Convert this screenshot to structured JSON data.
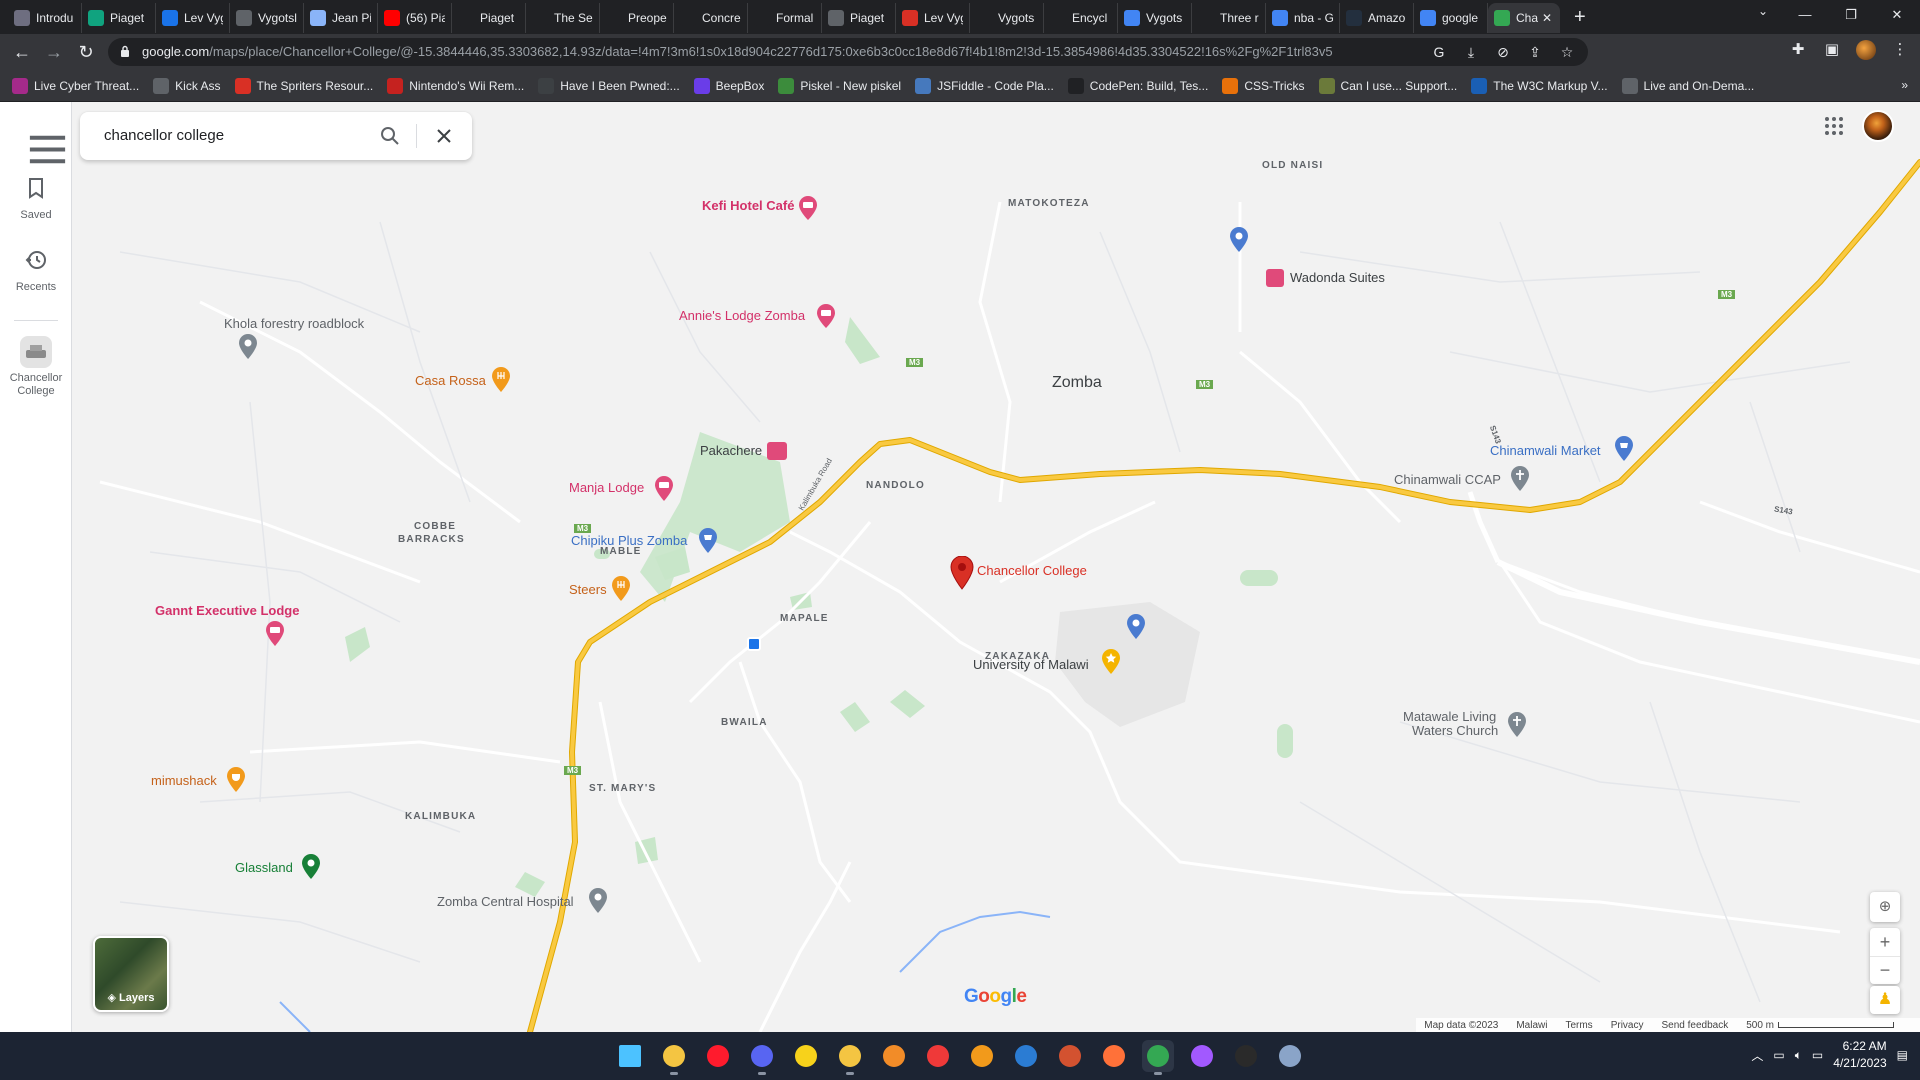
{
  "browser": {
    "tabs": [
      {
        "title": "Introdu",
        "icon": "openai-icon",
        "color": "#6e6e80"
      },
      {
        "title": "Piaget",
        "icon": "chatgpt-icon",
        "color": "#10a37f"
      },
      {
        "title": "Lev Vyg",
        "icon": "et-icon",
        "color": "#1a73e8"
      },
      {
        "title": "Vygotsl",
        "icon": "page-icon",
        "color": "#5f6368"
      },
      {
        "title": "Jean Pi",
        "icon": "page-icon",
        "color": "#8ab4f8"
      },
      {
        "title": "(56) Pia",
        "icon": "youtube-icon",
        "color": "#ff0000"
      },
      {
        "title": "Piaget",
        "icon": "wikipedia-icon",
        "color": "#202124"
      },
      {
        "title": "The Se",
        "icon": "wikipedia-icon",
        "color": "#202124"
      },
      {
        "title": "Preope",
        "icon": "wikipedia-icon",
        "color": "#202124"
      },
      {
        "title": "Concre",
        "icon": "wikipedia-icon",
        "color": "#202124"
      },
      {
        "title": "Formal",
        "icon": "wikipedia-icon",
        "color": "#202124"
      },
      {
        "title": "Piaget",
        "icon": "page-icon",
        "color": "#5f6368"
      },
      {
        "title": "Lev Vyg",
        "icon": "flag-icon",
        "color": "#d93025"
      },
      {
        "title": "Vygots",
        "icon": "page-icon",
        "color": "#202124"
      },
      {
        "title": "Encycl",
        "icon": "page-icon",
        "color": "#202124"
      },
      {
        "title": "Vygots",
        "icon": "google-icon",
        "color": "#4285f4"
      },
      {
        "title": "Three r",
        "icon": "wikipedia-icon",
        "color": "#202124"
      },
      {
        "title": "nba - G",
        "icon": "google-icon",
        "color": "#4285f4"
      },
      {
        "title": "Amazo",
        "icon": "amazon-icon",
        "color": "#232f3e"
      },
      {
        "title": "google",
        "icon": "google-icon",
        "color": "#4285f4"
      }
    ],
    "active_tab": {
      "title": "Cha",
      "icon": "maps-pin-icon"
    },
    "new_tab": "+",
    "url_host": "google.com",
    "url_path": "/maps/place/Chancellor+College/@-15.3844446,35.3303682,14.93z/data=!4m7!3m6!1s0x18d904c22776d175:0xe6b3c0cc18e8d67f!4b1!8m2!3d-15.3854986!4d35.3304522!16s%2Fg%2F1trl83v5",
    "bookmarks": [
      {
        "label": "Live Cyber Threat...",
        "color": "#a52a8a"
      },
      {
        "label": "Kick Ass",
        "color": "#5f6368"
      },
      {
        "label": "The Spriters Resour...",
        "color": "#d93025"
      },
      {
        "label": "Nintendo's Wii Rem...",
        "color": "#c5221f"
      },
      {
        "label": "Have I Been Pwned:...",
        "color": "#3c4043"
      },
      {
        "label": "BeepBox",
        "color": "#6a3de8"
      },
      {
        "label": "Piskel - New piskel",
        "color": "#3c8c3c"
      },
      {
        "label": "JSFiddle - Code Pla...",
        "color": "#4679bd"
      },
      {
        "label": "CodePen: Build, Tes...",
        "color": "#202124"
      },
      {
        "label": "CSS-Tricks",
        "color": "#e8710a"
      },
      {
        "label": "Can I use... Support...",
        "color": "#6b7a3a"
      },
      {
        "label": "The W3C Markup V...",
        "color": "#1a5fb4"
      },
      {
        "label": "Live and On-Dema...",
        "color": "#5f6368"
      }
    ],
    "bookmarks_more": "»"
  },
  "maps": {
    "search_value": "chancellor college",
    "rail": [
      {
        "label": "Saved",
        "icon": "bookmark-icon"
      },
      {
        "label": "Recents",
        "icon": "history-icon"
      },
      {
        "label": "Chancellor College",
        "icon": "place-thumb-icon"
      }
    ],
    "layers_label": "Layers",
    "places": [
      {
        "name": "Kefi Hotel Café",
        "kind": "hotel",
        "color": "#e04a7a"
      },
      {
        "name": "Annie's Lodge Zomba",
        "kind": "hotel",
        "color": "#e04a7a"
      },
      {
        "name": "Wadonda Suites",
        "kind": "hotel",
        "color": "#5f6368"
      },
      {
        "name": "Khola forestry roadblock",
        "kind": "landmark",
        "color": "#5f6368"
      },
      {
        "name": "Casa Rossa",
        "kind": "food",
        "color": "#e8710a"
      },
      {
        "name": "Zomba",
        "kind": "city",
        "color": "#3c4043"
      },
      {
        "name": "Pakachere",
        "kind": "hotel",
        "color": "#5f6368"
      },
      {
        "name": "Manja Lodge",
        "kind": "hotel",
        "color": "#e04a7a"
      },
      {
        "name": "Chipiku Plus Zomba",
        "kind": "shop",
        "color": "#4a7bd0"
      },
      {
        "name": "Chancellor College",
        "kind": "selected",
        "color": "#d93025"
      },
      {
        "name": "Steers",
        "kind": "food",
        "color": "#e8710a"
      },
      {
        "name": "Gannt Executive Lodge",
        "kind": "hotel",
        "color": "#e04a7a"
      },
      {
        "name": "University of Malawi",
        "kind": "university",
        "color": "#3c4043"
      },
      {
        "name": "Chinamwali Market",
        "kind": "shop",
        "color": "#4a7bd0"
      },
      {
        "name": "Chinamwali CCAP",
        "kind": "church",
        "color": "#7d8790"
      },
      {
        "name": "Matawale Living",
        "kind": "church",
        "color": "#7d8790"
      },
      {
        "name": "Waters Church",
        "kind": "church",
        "color": "#7d8790"
      },
      {
        "name": "mimushack",
        "kind": "food",
        "color": "#e8710a"
      },
      {
        "name": "Glassland",
        "kind": "park",
        "color": "#188038"
      },
      {
        "name": "Zomba Central Hospital",
        "kind": "hospital",
        "color": "#7d8790"
      }
    ],
    "areas": [
      "OLD NAISI",
      "MATOKOTEZA",
      "NANDOLO",
      "COBBE",
      "BARRACKS",
      "MABLE",
      "MAPALE",
      "ZAKAZAKA",
      "BWAILA",
      "ST. MARY'S",
      "KALIMBUKA"
    ],
    "road_labels": {
      "m3": "M3",
      "s143": "S143",
      "kalimbuka_road": "Kalimbuka Road"
    },
    "attribution": {
      "map_data": "Map data ©2023",
      "region": "Malawi",
      "terms": "Terms",
      "privacy": "Privacy",
      "feedback": "Send feedback",
      "scale": "500 m"
    },
    "controls": {
      "zoom_in": "+",
      "zoom_out": "−"
    },
    "brand": "Google",
    "colors": {
      "highway": "#f9c941",
      "highway_border": "#e0a800",
      "park": "#c8e6c9",
      "water": "#8ab4f8",
      "map_bg": "#f2f2f2",
      "selected_pin": "#d93025"
    }
  },
  "taskbar": {
    "apps": [
      {
        "name": "windows-start-icon",
        "color": "#4cc2ff"
      },
      {
        "name": "file-explorer-icon",
        "color": "#f4c542"
      },
      {
        "name": "opera-icon",
        "color": "#ff1b2d"
      },
      {
        "name": "discord-icon",
        "color": "#5865f2"
      },
      {
        "name": "notes-icon",
        "color": "#f7d21b"
      },
      {
        "name": "folder-icon",
        "color": "#f4c542"
      },
      {
        "name": "gdevelop-icon",
        "color": "#f28c28"
      },
      {
        "name": "vivaldi-icon",
        "color": "#ef3939"
      },
      {
        "name": "search-tool-icon",
        "color": "#f29a1b"
      },
      {
        "name": "word-icon",
        "color": "#2b7cd3"
      },
      {
        "name": "powerpoint-icon",
        "color": "#d35230"
      },
      {
        "name": "firefox-icon",
        "color": "#ff7139"
      },
      {
        "name": "chrome-icon",
        "color": "#34a853"
      },
      {
        "name": "figma-icon",
        "color": "#a259ff"
      },
      {
        "name": "epic-games-icon",
        "color": "#2a2a2a"
      },
      {
        "name": "settings-icon",
        "color": "#8aa4c8"
      }
    ],
    "time": "6:22 AM",
    "date": "4/21/2023"
  }
}
